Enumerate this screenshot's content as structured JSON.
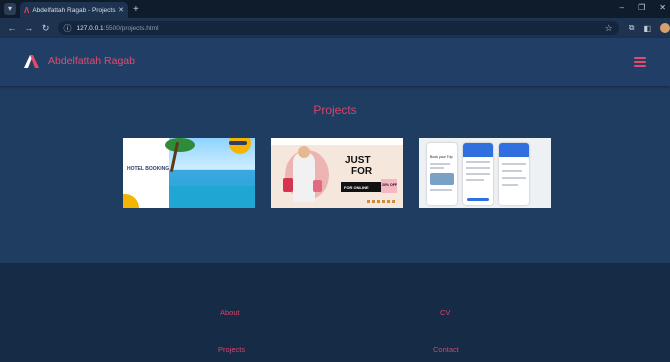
{
  "browser": {
    "tab_title": "Abdelfattah Ragab - Projects",
    "url_host": "127.0.0.1",
    "url_rest": ":5500/projects.html"
  },
  "site": {
    "brand": "Abdelfattah Ragab",
    "section_title": "Projects"
  },
  "footer": {
    "links": [
      {
        "label": "About"
      },
      {
        "label": "CV"
      },
      {
        "label": "Projects"
      },
      {
        "label": "Contact"
      }
    ]
  },
  "cards": {
    "hotel": {
      "title": "HOTEL BOOKING"
    },
    "fashion": {
      "headline": "JUST",
      "headline2": "FOR",
      "badge": "FOR ONLINE",
      "discount": "20% OFF"
    },
    "travel": {
      "title": "Book your Trip"
    }
  },
  "colors": {
    "accent": "#e34a6d",
    "page_bg": "#1f3c61",
    "footer_bg": "#152b46"
  }
}
